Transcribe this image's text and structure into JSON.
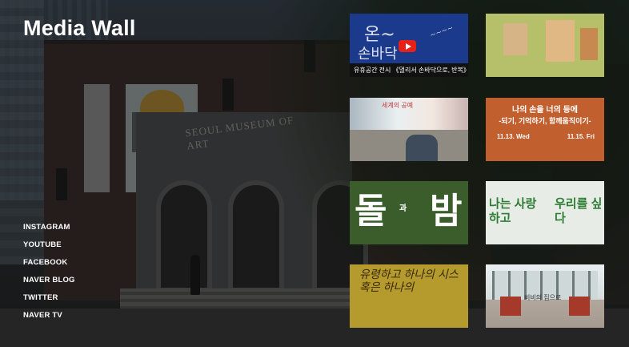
{
  "page": {
    "title": "Media Wall"
  },
  "background": {
    "museum_name": "SEOUL MUSEUM OF ART"
  },
  "social": [
    {
      "label": "INSTAGRAM"
    },
    {
      "label": "YOUTUBE"
    },
    {
      "label": "FACEBOOK"
    },
    {
      "label": "NAVER BLOG"
    },
    {
      "label": "TWITTER"
    },
    {
      "label": "NAVER TV"
    }
  ],
  "media": [
    {
      "caption": "유휴공간 전시 《멀리서 손바닥으로, 반복》",
      "play_icon": "youtube-play-icon"
    },
    {
      "caption": ""
    },
    {
      "caption": "",
      "text": "세계의 공예"
    },
    {
      "caption": "",
      "title": "나의 손을 너의 등에",
      "subtitle": "-되기, 기억하기, 함께움직이기-",
      "date_start": "11.13. Wed",
      "date_end": "11.15. Fri"
    },
    {
      "caption": "",
      "left": "돌",
      "middle": "과",
      "right": "밤"
    },
    {
      "caption": "",
      "left": "나는 사랑하고",
      "right": "우리를 싶다"
    },
    {
      "caption": "",
      "text": "유령하고 하나의 시스 혹은 하나의"
    },
    {
      "caption": "",
      "text": "비비의 집으로"
    }
  ]
}
